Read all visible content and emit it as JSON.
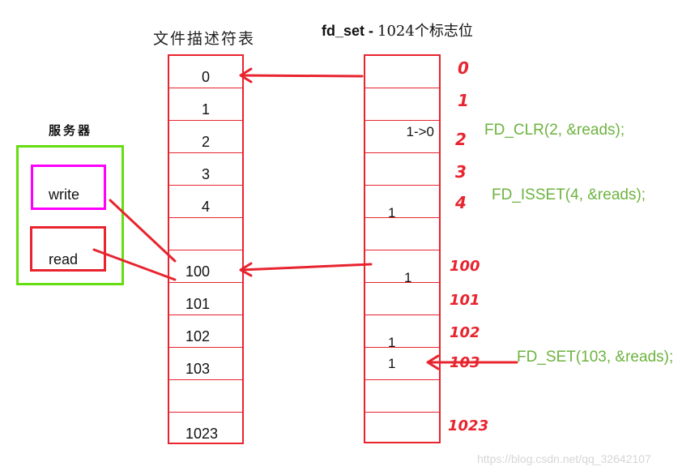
{
  "titles": {
    "fd_table": "文件描述符表",
    "fd_set_bold": "fd_set - ",
    "fd_set_rest": "1024个标志位"
  },
  "server": {
    "title": "服务器",
    "write_label": "write",
    "read_label": "read"
  },
  "fd_table": {
    "rows": [
      "0",
      "1",
      "2",
      "3",
      "4",
      "",
      "100",
      "101",
      "102",
      "103",
      "",
      "1023"
    ]
  },
  "fd_set": {
    "bits": [
      {
        "row": 2,
        "text": "1->0",
        "align": "right"
      },
      {
        "row": 4,
        "text": "1",
        "align": "bottom-left"
      },
      {
        "row": 6,
        "text": "1",
        "align": "center"
      },
      {
        "row": 8,
        "text": "1",
        "align": "bottom-left"
      },
      {
        "row": 9,
        "text": "1",
        "align": "left"
      }
    ],
    "index_labels": [
      "0",
      "1",
      "2",
      "3",
      "4",
      "100",
      "101",
      "102",
      "103",
      "1023"
    ]
  },
  "macros": {
    "clr": "FD_CLR(2, &reads);",
    "isset": "FD_ISSET(4, &reads);",
    "set": "FD_SET(103, &reads);"
  },
  "colors": {
    "table_border": "#e8242f",
    "arrow": "#e8242f",
    "server_border": "#66dd11",
    "write_border": "#ff00ff",
    "macro_text": "#6db33f"
  },
  "watermark": "https://blog.csdn.net/qq_32642107"
}
